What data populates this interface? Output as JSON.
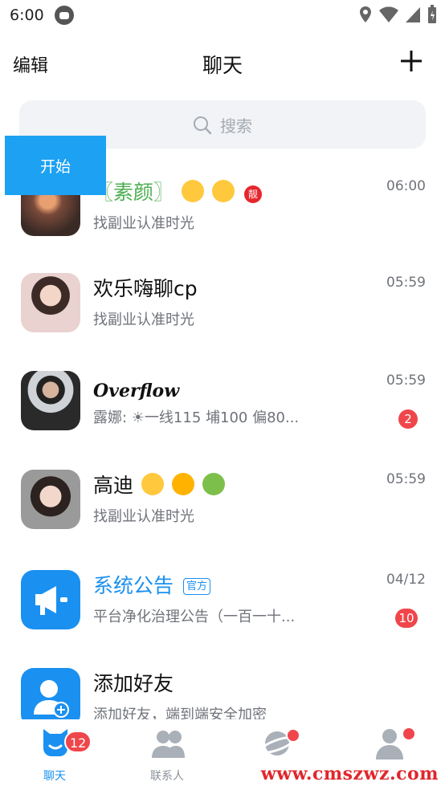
{
  "status_bar": {
    "time": "6:00"
  },
  "header": {
    "edit_label": "编辑",
    "title": "聊天"
  },
  "search": {
    "placeholder": "搜索"
  },
  "overlay": {
    "start_label": "开始"
  },
  "chats": [
    {
      "name": "〖素颜〗",
      "preview": "找副业认准时光",
      "time": "06:00",
      "badge": "",
      "liang": "靓"
    },
    {
      "name": "欢乐嗨聊cp",
      "preview": "找副业认准时光",
      "time": "05:59",
      "badge": ""
    },
    {
      "name": "Overflow",
      "preview": "露娜: ☀一线115 埔100 偏80...",
      "time": "05:59",
      "badge": "2"
    },
    {
      "name": "高迪",
      "preview": "找副业认准时光",
      "time": "05:59",
      "badge": ""
    },
    {
      "name": "系统公告",
      "official_tag": "官方",
      "preview": "平台净化治理公告（一百一十...",
      "time": "04/12",
      "badge": "10"
    },
    {
      "name": "添加好友",
      "preview": "添加好友，端到端安全加密",
      "time": "",
      "badge": ""
    }
  ],
  "tabbar": {
    "tabs": [
      {
        "label": "聊天",
        "active": true
      },
      {
        "label": "联系人",
        "active": false
      },
      {
        "label": "",
        "active": false
      },
      {
        "label": "",
        "active": false
      }
    ],
    "chat_badge": "12"
  },
  "watermark": "www.cmszwz.com",
  "colors": {
    "accent": "#1a90f0",
    "badge": "#f0464b",
    "overlay_button": "#1da1f2",
    "green_name": "#4caf50"
  }
}
